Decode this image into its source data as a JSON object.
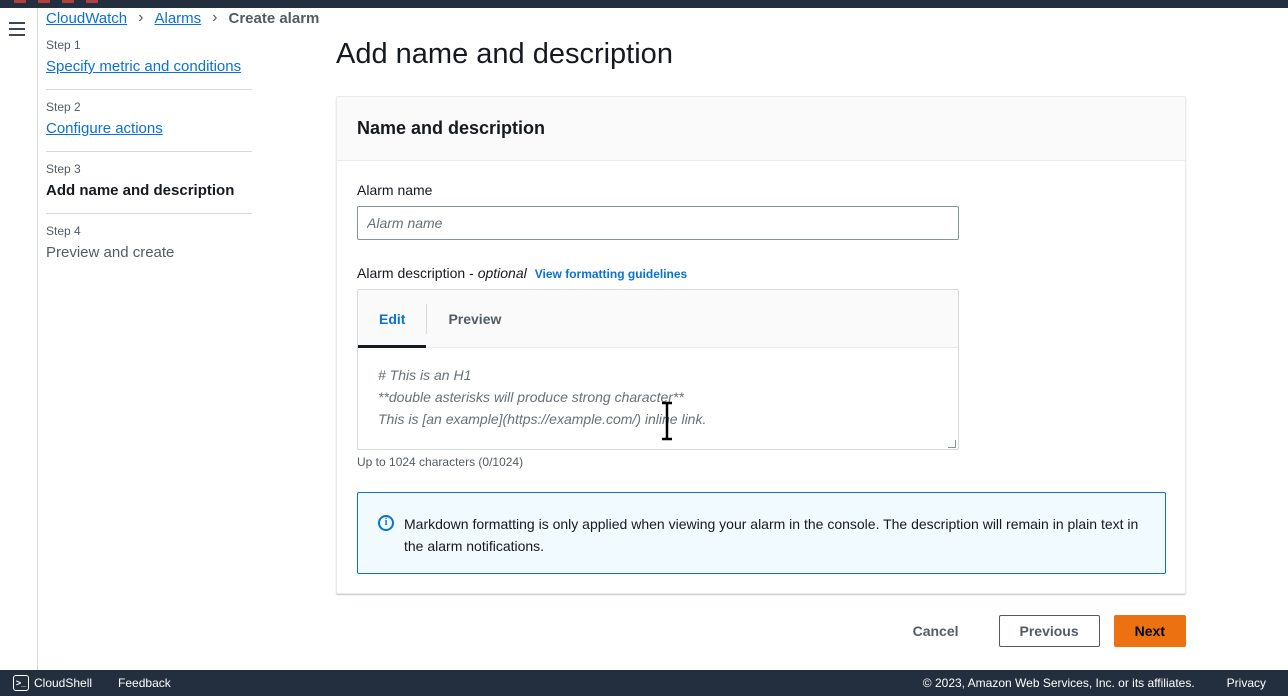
{
  "breadcrumb": {
    "items": [
      "CloudWatch",
      "Alarms"
    ],
    "current": "Create alarm"
  },
  "steps": [
    {
      "num": "Step 1",
      "label": "Specify metric and conditions"
    },
    {
      "num": "Step 2",
      "label": "Configure actions"
    },
    {
      "num": "Step 3",
      "label": "Add name and description"
    },
    {
      "num": "Step 4",
      "label": "Preview and create"
    }
  ],
  "page": {
    "title": "Add name and description"
  },
  "section": {
    "title": "Name and description"
  },
  "alarm_name": {
    "label": "Alarm name",
    "placeholder": "Alarm name",
    "value": ""
  },
  "alarm_description": {
    "label": "Alarm description -",
    "optional": "optional",
    "guidelines_link": "View formatting guidelines",
    "tabs": [
      "Edit",
      "Preview"
    ],
    "placeholder_lines": [
      "# This is an H1",
      "**double asterisks will produce strong character**",
      "This is [an example](https://example.com/) inline link."
    ],
    "constraint": "Up to 1024 characters (0/1024)"
  },
  "info_alert": {
    "text": "Markdown formatting is only applied when viewing your alarm in the console. The description will remain in plain text in the alarm notifications.",
    "icon": "info-icon"
  },
  "actions": {
    "cancel": "Cancel",
    "previous": "Previous",
    "next": "Next"
  },
  "footer": {
    "cloudshell": "CloudShell",
    "feedback": "Feedback",
    "copyright": "© 2023, Amazon Web Services, Inc. or its affiliates.",
    "privacy": "Privacy"
  },
  "colors": {
    "link": "#0972d3",
    "primary": "#ec7211",
    "nav_dark": "#232f3e",
    "info_bg": "#f1faff"
  }
}
